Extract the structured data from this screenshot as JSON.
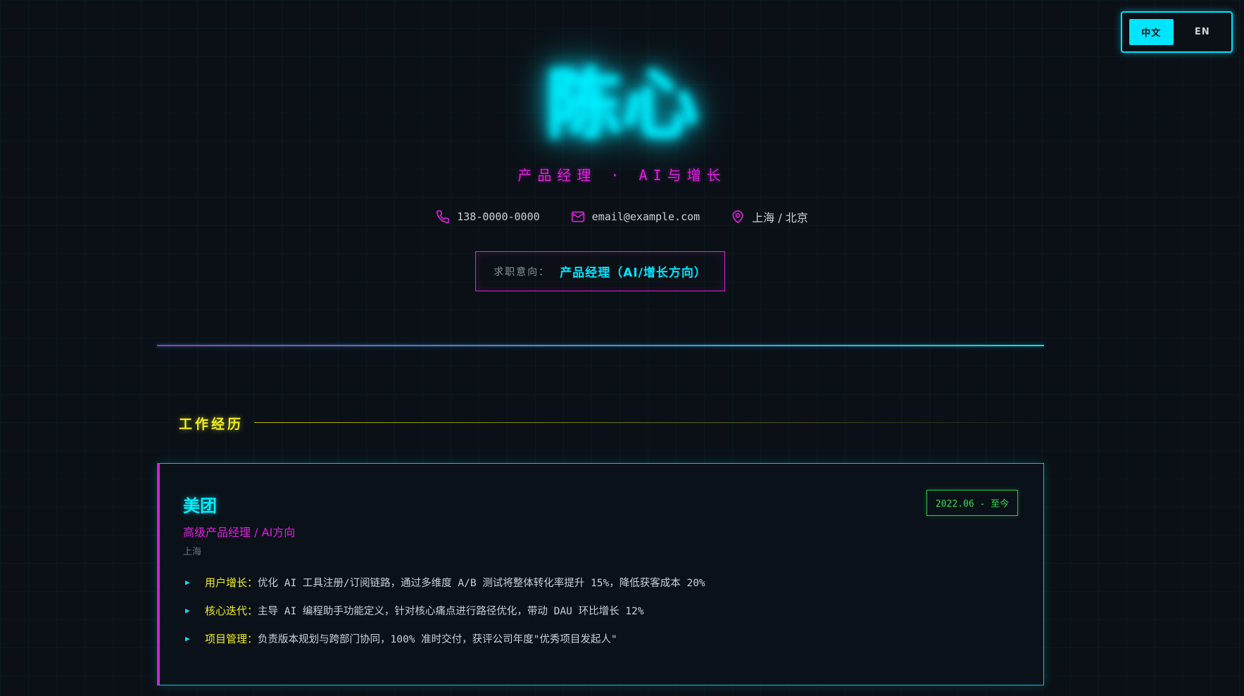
{
  "lang_toggle": {
    "zh": "中文",
    "en": "EN",
    "active": "zh"
  },
  "header": {
    "name": "陈心",
    "subtitle": "产品经理 · AI与增长",
    "contacts": {
      "phone": "138-0000-0000",
      "email": "email@example.com",
      "location": "上海 / 北京"
    },
    "intent": {
      "label": "求职意向：",
      "value": "产品经理（AI/增长方向）"
    }
  },
  "sections": {
    "experience_title": "工作经历"
  },
  "experience": [
    {
      "company": "美团",
      "role": "高级产品经理 / AI方向",
      "city": "上海",
      "period": "2022.06 - 至今",
      "bullets": [
        {
          "key": "用户增长：",
          "text": "优化 AI 工具注册/订阅链路，通过多维度 A/B 测试将整体转化率提升 15%，降低获客成本 20%"
        },
        {
          "key": "核心迭代：",
          "text": "主导 AI 编程助手功能定义，针对核心痛点进行路径优化，带动 DAU 环比增长 12%"
        },
        {
          "key": "项目管理：",
          "text": "负责版本规划与跨部门协同，100% 准时交付，获评公司年度\"优秀项目发起人\""
        }
      ]
    }
  ],
  "colors": {
    "background": "#0b1016",
    "cyan": "#00e5ff",
    "magenta": "#e020e0",
    "yellow": "#f2f01a",
    "green": "#30e050"
  },
  "icons": {
    "phone": "phone-icon",
    "email": "mail-icon",
    "location": "map-pin-icon",
    "bullet": "triangle-right-icon"
  }
}
